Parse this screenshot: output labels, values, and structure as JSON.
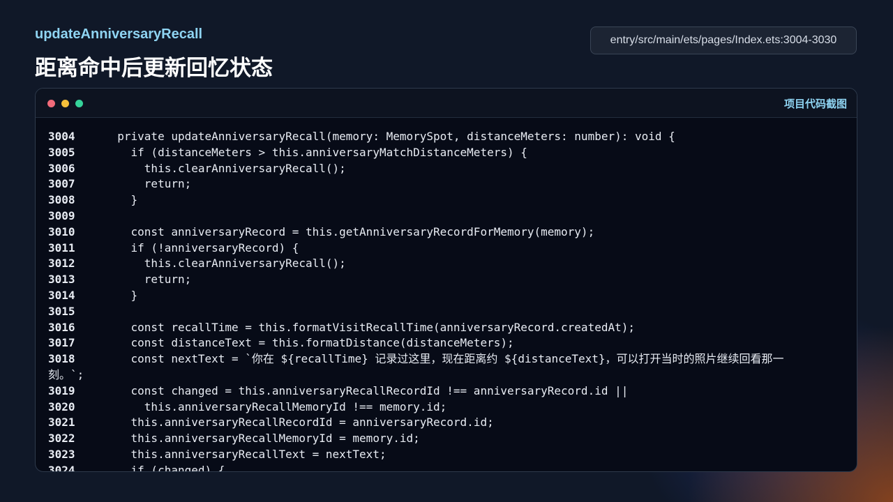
{
  "header": {
    "function_name": "updateAnniversaryRecall",
    "title": "距离命中后更新回忆状态",
    "file_path": "entry/src/main/ets/pages/Index.ets:3004-3030"
  },
  "window": {
    "label": "项目代码截图",
    "dots": [
      "red-dot",
      "yellow-dot",
      "green-dot"
    ]
  },
  "code": {
    "lines": [
      {
        "n": "3004",
        "t": "  private updateAnniversaryRecall(memory: MemorySpot, distanceMeters: number): void {"
      },
      {
        "n": "3005",
        "t": "    if (distanceMeters > this.anniversaryMatchDistanceMeters) {"
      },
      {
        "n": "3006",
        "t": "      this.clearAnniversaryRecall();"
      },
      {
        "n": "3007",
        "t": "      return;"
      },
      {
        "n": "3008",
        "t": "    }"
      },
      {
        "n": "3009",
        "t": ""
      },
      {
        "n": "3010",
        "t": "    const anniversaryRecord = this.getAnniversaryRecordForMemory(memory);"
      },
      {
        "n": "3011",
        "t": "    if (!anniversaryRecord) {"
      },
      {
        "n": "3012",
        "t": "      this.clearAnniversaryRecall();"
      },
      {
        "n": "3013",
        "t": "      return;"
      },
      {
        "n": "3014",
        "t": "    }"
      },
      {
        "n": "3015",
        "t": ""
      },
      {
        "n": "3016",
        "t": "    const recallTime = this.formatVisitRecallTime(anniversaryRecord.createdAt);"
      },
      {
        "n": "3017",
        "t": "    const distanceText = this.formatDistance(distanceMeters);"
      },
      {
        "n": "3018",
        "t": "    const nextText = `你在 ${recallTime} 记录过这里，现在距离约 ${distanceText}，可以打开当时的照片继续回看那一",
        "wrap": "刻。`;"
      },
      {
        "n": "3019",
        "t": "    const changed = this.anniversaryRecallRecordId !== anniversaryRecord.id ||"
      },
      {
        "n": "3020",
        "t": "      this.anniversaryRecallMemoryId !== memory.id;"
      },
      {
        "n": "3021",
        "t": "    this.anniversaryRecallRecordId = anniversaryRecord.id;"
      },
      {
        "n": "3022",
        "t": "    this.anniversaryRecallMemoryId = memory.id;"
      },
      {
        "n": "3023",
        "t": "    this.anniversaryRecallText = nextText;"
      },
      {
        "n": "3024",
        "t": "    if (changed) {"
      }
    ]
  }
}
